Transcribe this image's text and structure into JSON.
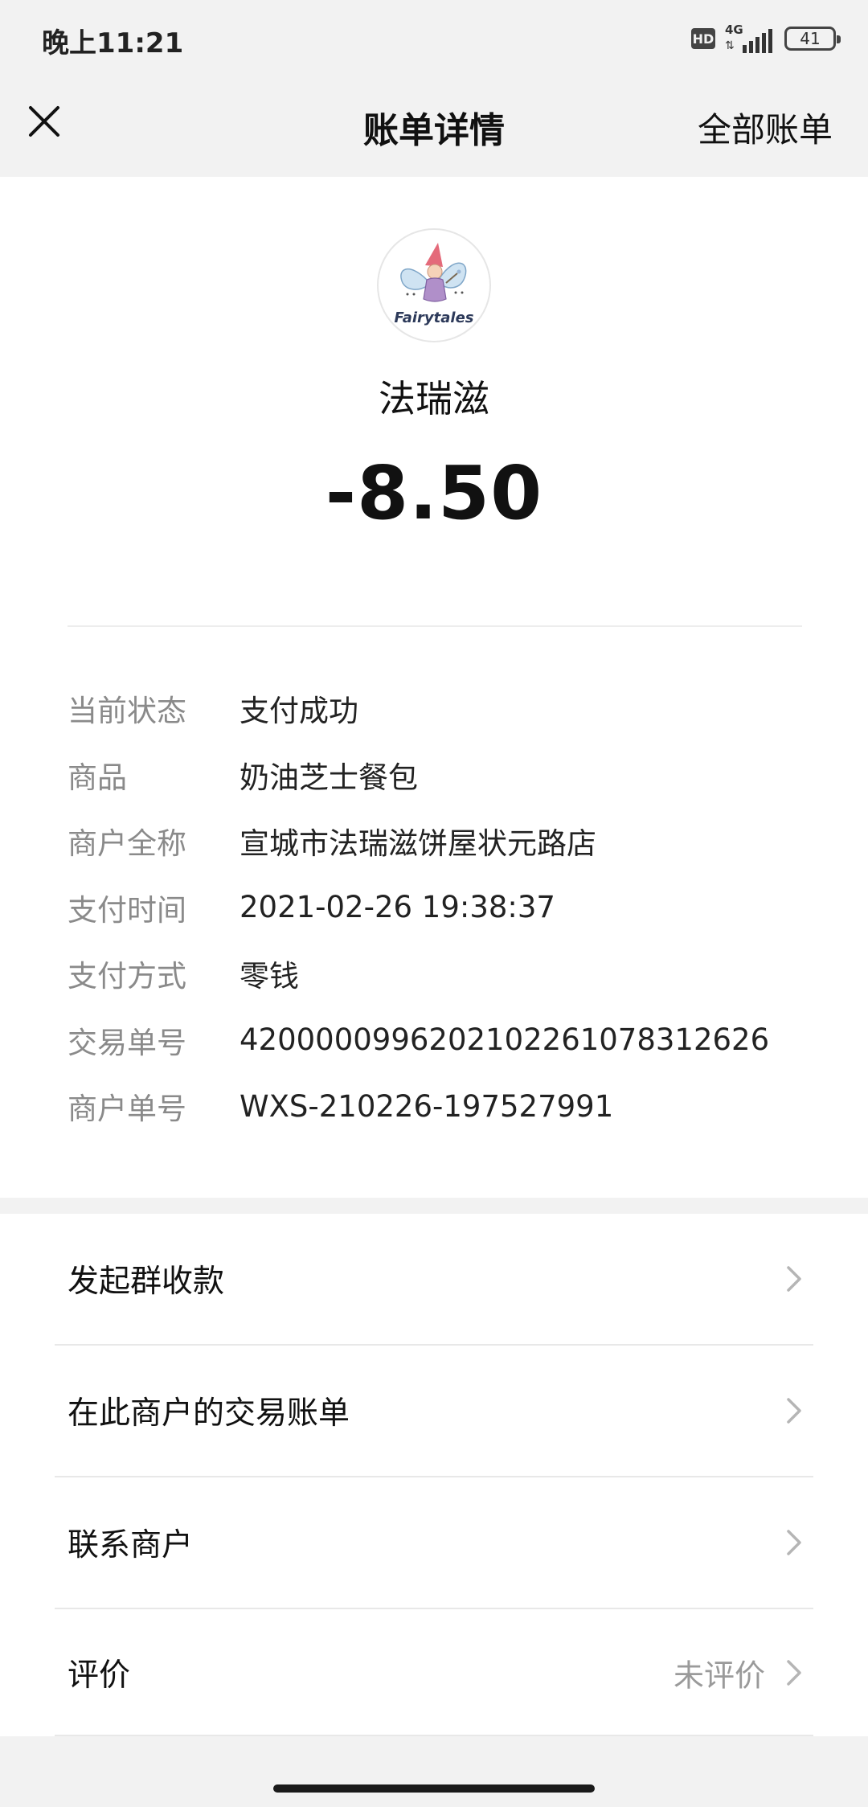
{
  "status_bar": {
    "time": "晚上11:21",
    "hd": "HD",
    "network": "4G",
    "battery": "41"
  },
  "nav": {
    "title": "账单详情",
    "right_action": "全部账单"
  },
  "merchant": {
    "logo_text": "Fairytales",
    "name": "法瑞滋",
    "amount": "-8.50"
  },
  "details": [
    {
      "label": "当前状态",
      "value": "支付成功"
    },
    {
      "label": "商品",
      "value": "奶油芝士餐包"
    },
    {
      "label": "商户全称",
      "value": "宣城市法瑞滋饼屋状元路店"
    },
    {
      "label": "支付时间",
      "value": "2021-02-26 19:38:37"
    },
    {
      "label": "支付方式",
      "value": "零钱"
    },
    {
      "label": "交易单号",
      "value": "4200000996202102261078312626"
    },
    {
      "label": "商户单号",
      "value": "WXS-210226-197527991"
    }
  ],
  "actions": [
    {
      "label": "发起群收款",
      "sub": ""
    },
    {
      "label": "在此商户的交易账单",
      "sub": ""
    },
    {
      "label": "联系商户",
      "sub": ""
    },
    {
      "label": "评价",
      "sub": "未评价"
    }
  ]
}
